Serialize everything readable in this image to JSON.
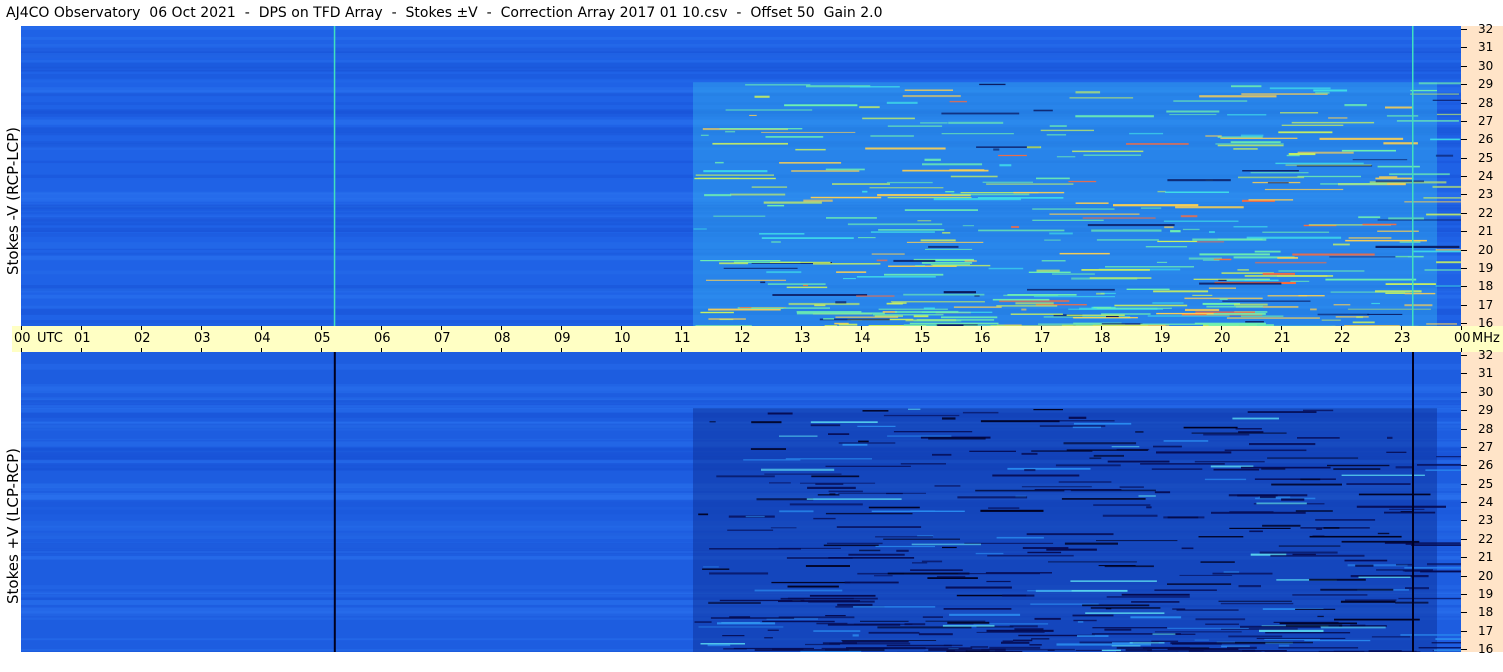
{
  "title": "AJ4CO Observatory  06 Oct 2021  -  DPS on TFD Array  -  Stokes ±V  -  Correction Array 2017 01 10.csv  -  Offset 50  Gain 2.0",
  "colors": {
    "background": "#2060e0",
    "axis_bg": "#ffffc4",
    "freq_strip_bg": "#ffe4c8"
  },
  "chart_data": [
    {
      "type": "heatmap",
      "panel": "top",
      "ylabel": "Stokes -V (RCP-LCP)",
      "x_ticks": [
        "00",
        "01",
        "02",
        "03",
        "04",
        "05",
        "06",
        "07",
        "08",
        "09",
        "10",
        "11",
        "12",
        "13",
        "14",
        "15",
        "16",
        "17",
        "18",
        "19",
        "20",
        "21",
        "22",
        "23",
        "00"
      ],
      "x_unit": "UTC",
      "xlim": [
        0,
        24
      ],
      "y_ticks": [
        "32",
        "31",
        "30",
        "29",
        "28",
        "27",
        "26",
        "25",
        "24",
        "23",
        "22",
        "21",
        "20",
        "19",
        "18",
        "17",
        "16"
      ],
      "y_unit": "MHz",
      "ylim": [
        16,
        32
      ],
      "vertical_markers_utc": [
        5.23,
        23.2
      ],
      "marker_color": "#40e0c0",
      "active_region_utc": [
        11.2,
        23.6
      ],
      "active_band_mhz": [
        16,
        29
      ],
      "activity_polarity": "bright"
    },
    {
      "type": "heatmap",
      "panel": "bottom",
      "ylabel": "Stokes +V (LCP-RCP)",
      "x_ticks": [
        "00",
        "01",
        "02",
        "03",
        "04",
        "05",
        "06",
        "07",
        "08",
        "09",
        "10",
        "11",
        "12",
        "13",
        "14",
        "15",
        "16",
        "17",
        "18",
        "19",
        "20",
        "21",
        "22",
        "23",
        "00"
      ],
      "x_unit": "UTC",
      "xlim": [
        0,
        24
      ],
      "y_ticks": [
        "32",
        "31",
        "30",
        "29",
        "28",
        "27",
        "26",
        "25",
        "24",
        "23",
        "22",
        "21",
        "20",
        "19",
        "18",
        "17",
        "16"
      ],
      "y_unit": "MHz",
      "ylim": [
        16,
        32
      ],
      "vertical_markers_utc": [
        5.23,
        23.2
      ],
      "marker_color": "#000020",
      "active_region_utc": [
        11.2,
        23.6
      ],
      "active_band_mhz": [
        16,
        29
      ],
      "activity_polarity": "dark"
    }
  ],
  "axis": {
    "utc_label": "UTC",
    "mhz_label": "MHz"
  }
}
